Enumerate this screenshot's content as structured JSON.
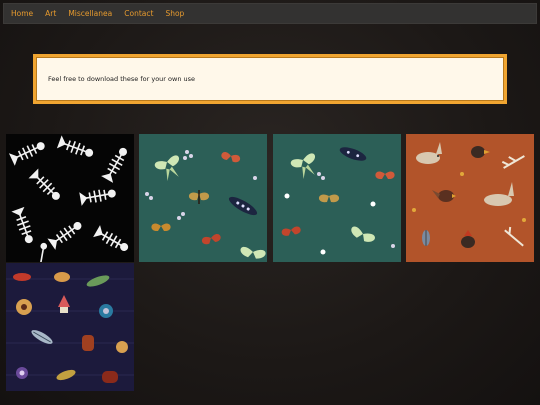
{
  "nav": {
    "items": [
      {
        "label": "Home"
      },
      {
        "label": "Art"
      },
      {
        "label": "Miscellanea"
      },
      {
        "label": "Contact"
      },
      {
        "label": "Shop"
      }
    ]
  },
  "notice": {
    "text": "Feel free to download these for your own use"
  },
  "gallery": {
    "patterns": [
      {
        "name": "fish-skeletons",
        "background": "#050505"
      },
      {
        "name": "luna-moths",
        "background": "#2c5f57"
      },
      {
        "name": "luna-moths-variant",
        "background": "#2c5f57"
      },
      {
        "name": "hares-and-birds",
        "background": "#b2542a"
      },
      {
        "name": "fishing-lures",
        "background": "#1c1a3c"
      }
    ]
  },
  "colors": {
    "accent": "#e69a2e",
    "notice_border": "#f0a531",
    "notice_bg": "#fff8ea"
  }
}
